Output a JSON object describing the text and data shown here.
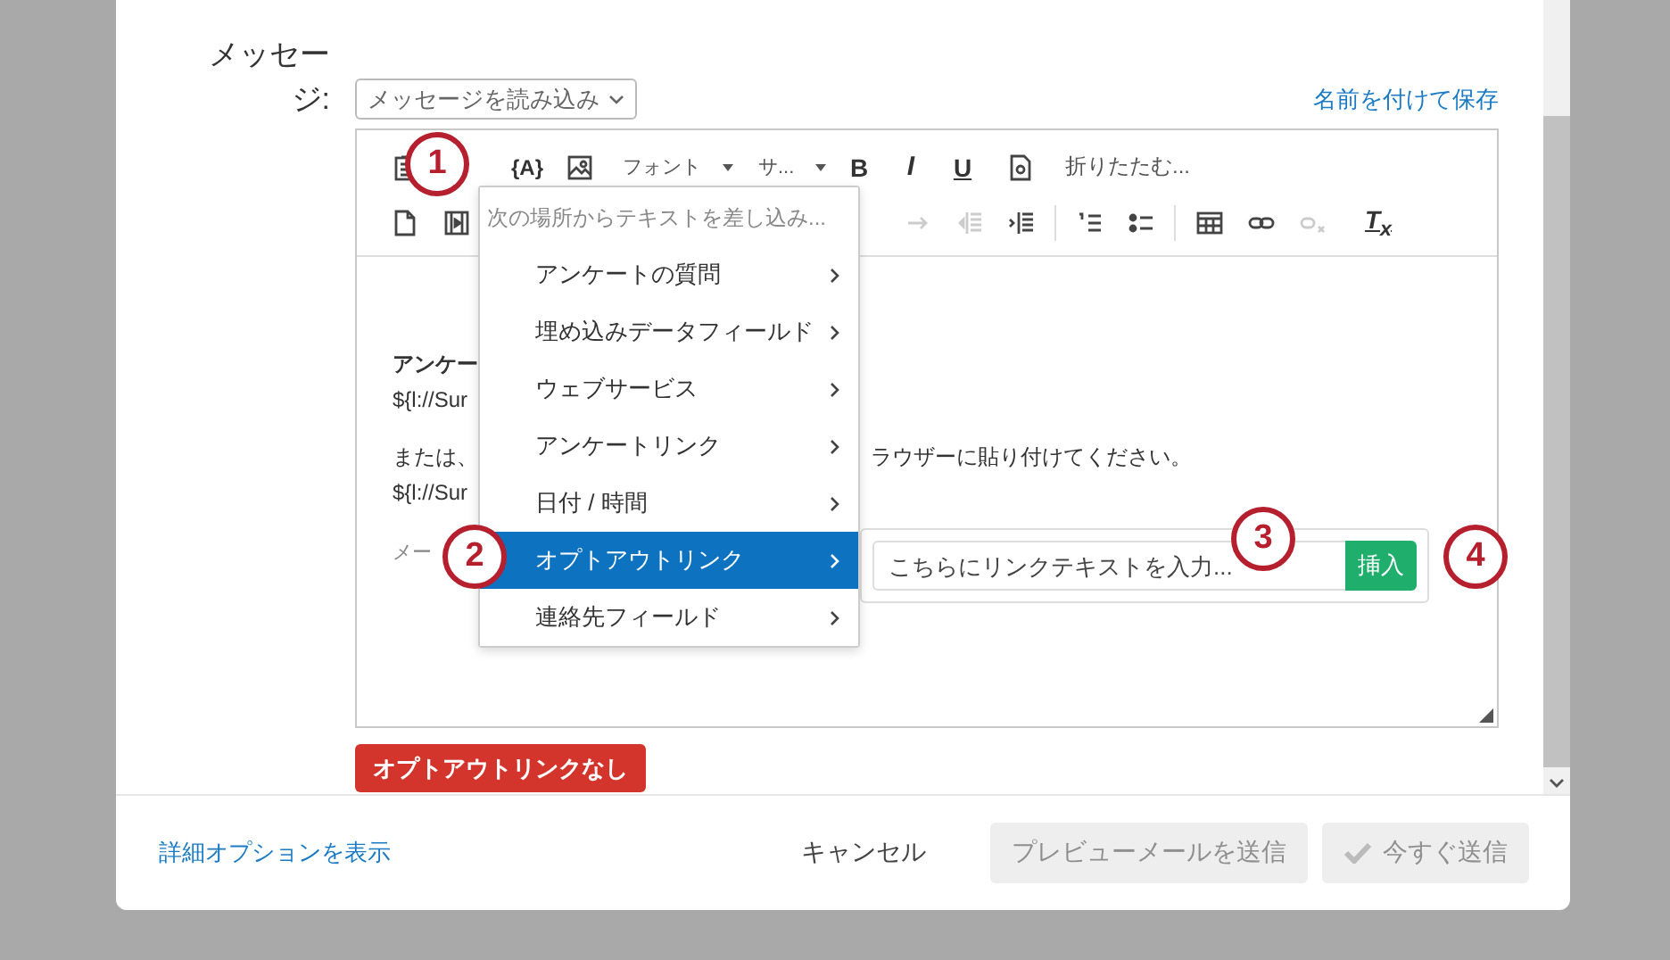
{
  "field_label": {
    "line_1": "メッセー",
    "line_2": "ジ:"
  },
  "load_message_dropdown": "メッセージを読み込み",
  "save_as_link": "名前を付けて保存",
  "toolbar": {
    "piped_text": "{A}",
    "font": "フォント",
    "size": "サ...",
    "bold": "B",
    "italic": "I",
    "underline": "U",
    "collapse": "折りたたむ...",
    "clear_format": "T$_{x}$",
    "redo_disabled": true,
    "outdent_disabled": true,
    "unlink_disabled": true
  },
  "insert_menu": {
    "placeholder": "次の場所からテキストを差し込み...",
    "items": [
      {
        "label": "アンケートの質問",
        "selected": false
      },
      {
        "label": "埋め込みデータフィールド",
        "selected": false
      },
      {
        "label": "ウェブサービス",
        "selected": false
      },
      {
        "label": "アンケートリンク",
        "selected": false
      },
      {
        "label": "日付 / 時間",
        "selected": false
      },
      {
        "label": "オプトアウトリンク",
        "selected": true
      },
      {
        "label": "連絡先フィールド",
        "selected": false
      }
    ]
  },
  "editor_body": [
    {
      "kind": "heading",
      "left": "アンケー"
    },
    {
      "kind": "code",
      "left": "${l://Sur"
    },
    {
      "kind": "text",
      "left": "または、",
      "right": "ラウザーに貼り付けてください。"
    },
    {
      "kind": "code",
      "left": "${l://Sur"
    },
    {
      "kind": "note",
      "left": "メー"
    }
  ],
  "link_popup": {
    "placeholder": "こちらにリンクテキストを入力...",
    "button": "挿入"
  },
  "opt_out_button": "オプトアウトリンクなし",
  "callouts": [
    "1",
    "2",
    "3",
    "4"
  ],
  "footer": {
    "details_link": "詳細オプションを表示",
    "cancel": "キャンセル",
    "preview_button": {
      "label": "プレビューメールを送信",
      "disabled": true
    },
    "send_button": {
      "label": "今すぐ送信",
      "disabled": true
    }
  }
}
